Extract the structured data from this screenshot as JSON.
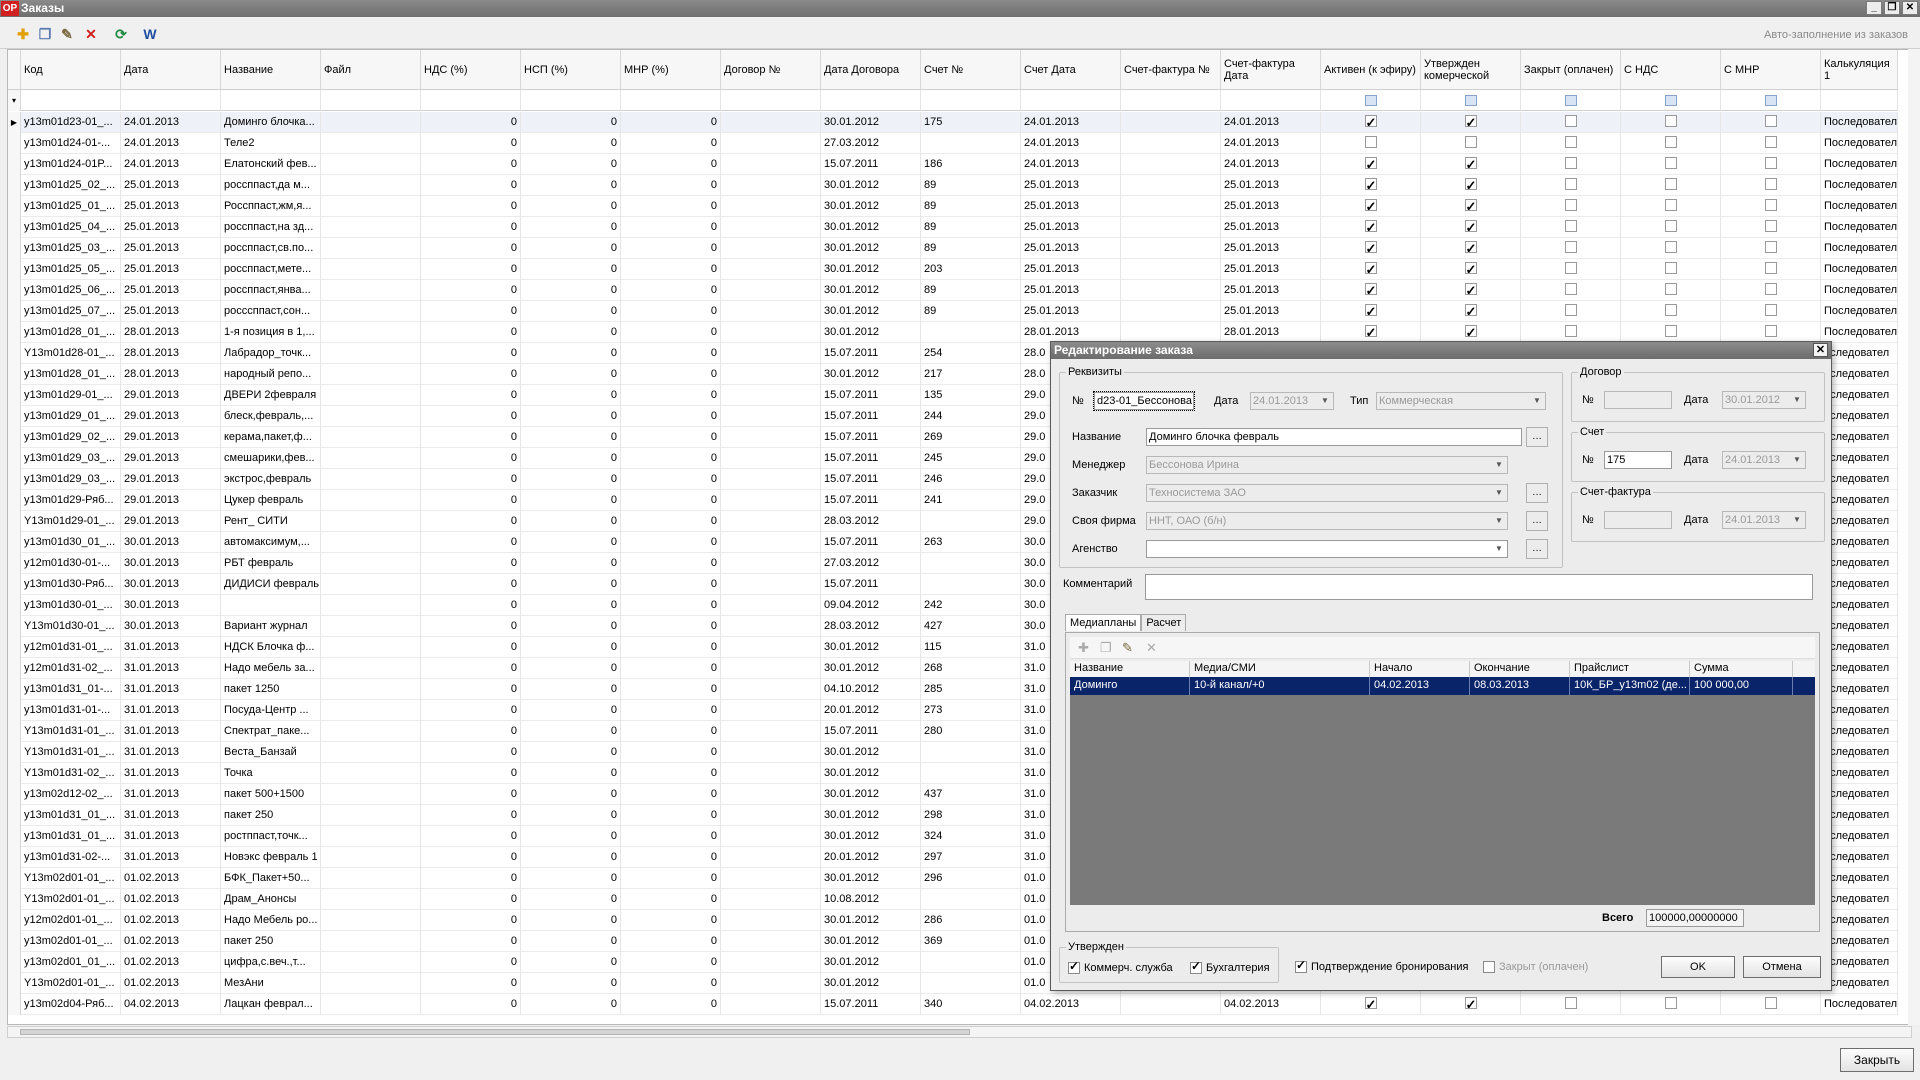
{
  "window": {
    "title": "Заказы",
    "logo": "OP"
  },
  "toolbar": {
    "autofill": "Авто-заполнение из заказов"
  },
  "columns": [
    {
      "label": "Код",
      "w": 100
    },
    {
      "label": "Дата",
      "w": 100
    },
    {
      "label": "Название",
      "w": 100
    },
    {
      "label": "Файл",
      "w": 100
    },
    {
      "label": "НДС (%)",
      "w": 100
    },
    {
      "label": "НСП (%)",
      "w": 100
    },
    {
      "label": "МНР (%)",
      "w": 100
    },
    {
      "label": "Договор №",
      "w": 100
    },
    {
      "label": "Дата Договора",
      "w": 100
    },
    {
      "label": "Счет №",
      "w": 100
    },
    {
      "label": "Счет Дата",
      "w": 100
    },
    {
      "label": "Счет-фактура №",
      "w": 100
    },
    {
      "label": "Счет-фактура Дата",
      "w": 100
    },
    {
      "label": "Активен (к эфиру)",
      "w": 100
    },
    {
      "label": "Утвержден комерческой",
      "w": 100
    },
    {
      "label": "Закрыт (оплачен)",
      "w": 100
    },
    {
      "label": "С НДС",
      "w": 100
    },
    {
      "label": "С МНР",
      "w": 100
    },
    {
      "label": "Калькуляция 1",
      "w": 77
    }
  ],
  "rows": [
    [
      "y13m01d23-01_...",
      "24.01.2013",
      "Доминго блочка...",
      "",
      "0",
      "0",
      "0",
      "",
      "30.01.2012",
      "175",
      "24.01.2013",
      "",
      "24.01.2013",
      1,
      1,
      0,
      0,
      0,
      "Последовател"
    ],
    [
      "y13m01d24-01-...",
      "24.01.2013",
      "Теле2",
      "",
      "0",
      "0",
      "0",
      "",
      "27.03.2012",
      "",
      "24.01.2013",
      "",
      "24.01.2013",
      0,
      0,
      0,
      0,
      0,
      "Последовател"
    ],
    [
      "y13m01d24-01P...",
      "24.01.2013",
      "Елатонский фев...",
      "",
      "0",
      "0",
      "0",
      "",
      "15.07.2011",
      "186",
      "24.01.2013",
      "",
      "24.01.2013",
      1,
      1,
      0,
      0,
      0,
      "Последовател"
    ],
    [
      "y13m01d25_02_...",
      "25.01.2013",
      "россппаст,да м...",
      "",
      "0",
      "0",
      "0",
      "",
      "30.01.2012",
      "89",
      "25.01.2013",
      "",
      "25.01.2013",
      1,
      1,
      0,
      0,
      0,
      "Последовател"
    ],
    [
      "y13m01d25_01_...",
      "25.01.2013",
      "Россппаст,жм,я...",
      "",
      "0",
      "0",
      "0",
      "",
      "30.01.2012",
      "89",
      "25.01.2013",
      "",
      "25.01.2013",
      1,
      1,
      0,
      0,
      0,
      "Последовател"
    ],
    [
      "y13m01d25_04_...",
      "25.01.2013",
      "россппаст,на зд...",
      "",
      "0",
      "0",
      "0",
      "",
      "30.01.2012",
      "89",
      "25.01.2013",
      "",
      "25.01.2013",
      1,
      1,
      0,
      0,
      0,
      "Последовател"
    ],
    [
      "y13m01d25_03_...",
      "25.01.2013",
      "россппаст,св.по...",
      "",
      "0",
      "0",
      "0",
      "",
      "30.01.2012",
      "89",
      "25.01.2013",
      "",
      "25.01.2013",
      1,
      1,
      0,
      0,
      0,
      "Последовател"
    ],
    [
      "y13m01d25_05_...",
      "25.01.2013",
      "россппаст,мете...",
      "",
      "0",
      "0",
      "0",
      "",
      "30.01.2012",
      "203",
      "25.01.2013",
      "",
      "25.01.2013",
      1,
      1,
      0,
      0,
      0,
      "Последовател"
    ],
    [
      "y13m01d25_06_...",
      "25.01.2013",
      "россппаст,янва...",
      "",
      "0",
      "0",
      "0",
      "",
      "30.01.2012",
      "89",
      "25.01.2013",
      "",
      "25.01.2013",
      1,
      1,
      0,
      0,
      0,
      "Последовател"
    ],
    [
      "y13m01d25_07_...",
      "25.01.2013",
      "росссппаст,сон...",
      "",
      "0",
      "0",
      "0",
      "",
      "30.01.2012",
      "89",
      "25.01.2013",
      "",
      "25.01.2013",
      1,
      1,
      0,
      0,
      0,
      "Последовател"
    ],
    [
      "y13m01d28_01_...",
      "28.01.2013",
      "1-я позиция в 1,...",
      "",
      "0",
      "0",
      "0",
      "",
      "30.01.2012",
      "",
      "28.01.2013",
      "",
      "28.01.2013",
      1,
      1,
      0,
      0,
      0,
      "Последовател"
    ],
    [
      "Y13m01d28-01_...",
      "28.01.2013",
      "Лабрадор_точк...",
      "",
      "0",
      "0",
      "0",
      "",
      "15.07.2011",
      "254",
      "28.0",
      "",
      "",
      0,
      0,
      0,
      0,
      0,
      "оследовател"
    ],
    [
      "y13m01d28_01_...",
      "28.01.2013",
      "народный репо...",
      "",
      "0",
      "0",
      "0",
      "",
      "30.01.2012",
      "217",
      "28.0",
      "",
      "",
      0,
      0,
      0,
      0,
      0,
      "оследовател"
    ],
    [
      "y13m01d29-01_...",
      "29.01.2013",
      "ДВЕРИ 2февраля",
      "",
      "0",
      "0",
      "0",
      "",
      "15.07.2011",
      "135",
      "29.0",
      "",
      "",
      0,
      0,
      0,
      0,
      0,
      "оследовател"
    ],
    [
      "y13m01d29_01_...",
      "29.01.2013",
      "блеск,февраль,...",
      "",
      "0",
      "0",
      "0",
      "",
      "15.07.2011",
      "244",
      "29.0",
      "",
      "",
      0,
      0,
      0,
      0,
      0,
      "оследовател"
    ],
    [
      "y13m01d29_02_...",
      "29.01.2013",
      "керама,пакет,ф...",
      "",
      "0",
      "0",
      "0",
      "",
      "15.07.2011",
      "269",
      "29.0",
      "",
      "",
      0,
      0,
      0,
      0,
      0,
      "оследовател"
    ],
    [
      "y13m01d29_03_...",
      "29.01.2013",
      "смешарики,фев...",
      "",
      "0",
      "0",
      "0",
      "",
      "15.07.2011",
      "245",
      "29.0",
      "",
      "",
      0,
      0,
      0,
      0,
      0,
      "оследовател"
    ],
    [
      "y13m01d29_03_...",
      "29.01.2013",
      "экстрос,февраль",
      "",
      "0",
      "0",
      "0",
      "",
      "15.07.2011",
      "246",
      "29.0",
      "",
      "",
      0,
      0,
      0,
      0,
      0,
      "оследовател"
    ],
    [
      "y13m01d29-Ряб...",
      "29.01.2013",
      "Цукер февраль",
      "",
      "0",
      "0",
      "0",
      "",
      "15.07.2011",
      "241",
      "29.0",
      "",
      "",
      0,
      0,
      0,
      0,
      0,
      "оследовател"
    ],
    [
      "Y13m01d29-01_...",
      "29.01.2013",
      "Рент_ СИТИ",
      "",
      "0",
      "0",
      "0",
      "",
      "28.03.2012",
      "",
      "29.0",
      "",
      "",
      0,
      0,
      0,
      0,
      0,
      "оследовател"
    ],
    [
      "y13m01d30_01_...",
      "30.01.2013",
      "автомаксимум,...",
      "",
      "0",
      "0",
      "0",
      "",
      "15.07.2011",
      "263",
      "30.0",
      "",
      "",
      0,
      0,
      0,
      0,
      0,
      "оследовател"
    ],
    [
      "y12m01d30-01-...",
      "30.01.2013",
      "РБТ февраль",
      "",
      "0",
      "0",
      "0",
      "",
      "27.03.2012",
      "",
      "30.0",
      "",
      "",
      0,
      0,
      0,
      0,
      0,
      "оследовател"
    ],
    [
      "y13m01d30-Ряб...",
      "30.01.2013",
      "ДИДИСИ февраль",
      "",
      "0",
      "0",
      "0",
      "",
      "15.07.2011",
      "",
      "30.0",
      "",
      "",
      0,
      0,
      0,
      0,
      0,
      "оследовател"
    ],
    [
      "y13m01d30-01_...",
      "30.01.2013",
      "",
      "",
      "0",
      "0",
      "0",
      "",
      "09.04.2012",
      "242",
      "30.0",
      "",
      "",
      0,
      0,
      0,
      0,
      0,
      "оследовател"
    ],
    [
      "Y13m01d30-01_...",
      "30.01.2013",
      "Вариант журнал",
      "",
      "0",
      "0",
      "0",
      "",
      "28.03.2012",
      "427",
      "30.0",
      "",
      "",
      0,
      0,
      0,
      0,
      0,
      "оследовател"
    ],
    [
      "y12m01d31-01_...",
      "31.01.2013",
      "НДСК Блочка ф...",
      "",
      "0",
      "0",
      "0",
      "",
      "30.01.2012",
      "115",
      "31.0",
      "",
      "",
      0,
      0,
      0,
      0,
      0,
      "оследовател"
    ],
    [
      "y12m01d31-02_...",
      "31.01.2013",
      "Надо мебель за...",
      "",
      "0",
      "0",
      "0",
      "",
      "30.01.2012",
      "268",
      "31.0",
      "",
      "",
      0,
      0,
      0,
      0,
      0,
      "оследовател"
    ],
    [
      "y13m01d31_01-...",
      "31.01.2013",
      "пакет 1250",
      "",
      "0",
      "0",
      "0",
      "",
      "04.10.2012",
      "285",
      "31.0",
      "",
      "",
      0,
      0,
      0,
      0,
      0,
      "оследовател"
    ],
    [
      "y13m01d31-01-...",
      "31.01.2013",
      "Посуда-Центр ...",
      "",
      "0",
      "0",
      "0",
      "",
      "20.01.2012",
      "273",
      "31.0",
      "",
      "",
      0,
      0,
      0,
      0,
      0,
      "оследовател"
    ],
    [
      "Y13m01d31-01_...",
      "31.01.2013",
      "Спектрат_паке...",
      "",
      "0",
      "0",
      "0",
      "",
      "15.07.2011",
      "280",
      "31.0",
      "",
      "",
      0,
      0,
      0,
      0,
      0,
      "оследовател"
    ],
    [
      "Y13m01d31-01_...",
      "31.01.2013",
      "Веста_Банзай",
      "",
      "0",
      "0",
      "0",
      "",
      "30.01.2012",
      "",
      "31.0",
      "",
      "",
      0,
      0,
      0,
      0,
      0,
      "оследовател"
    ],
    [
      "Y13m01d31-02_...",
      "31.01.2013",
      "Точка",
      "",
      "0",
      "0",
      "0",
      "",
      "30.01.2012",
      "",
      "31.0",
      "",
      "",
      0,
      0,
      0,
      0,
      0,
      "оследовател"
    ],
    [
      "y13m02d12-02_...",
      "31.01.2013",
      "пакет 500+1500",
      "",
      "0",
      "0",
      "0",
      "",
      "30.01.2012",
      "437",
      "31.0",
      "",
      "",
      0,
      0,
      0,
      0,
      0,
      "оследовател"
    ],
    [
      "y13m01d31_01_...",
      "31.01.2013",
      "пакет 250",
      "",
      "0",
      "0",
      "0",
      "",
      "30.01.2012",
      "298",
      "31.0",
      "",
      "",
      0,
      0,
      0,
      0,
      0,
      "оследовател"
    ],
    [
      "y13m01d31_01_...",
      "31.01.2013",
      "ростппаст,точк...",
      "",
      "0",
      "0",
      "0",
      "",
      "30.01.2012",
      "324",
      "31.0",
      "",
      "",
      0,
      0,
      0,
      0,
      0,
      "оследовател"
    ],
    [
      "y13m01d31-02-...",
      "31.01.2013",
      "Новэкс февраль 1",
      "",
      "0",
      "0",
      "0",
      "",
      "20.01.2012",
      "297",
      "31.0",
      "",
      "",
      0,
      0,
      0,
      0,
      0,
      "оследовател"
    ],
    [
      "Y13m02d01-01_...",
      "01.02.2013",
      "БФК_Пакет+50...",
      "",
      "0",
      "0",
      "0",
      "",
      "30.01.2012",
      "296",
      "01.0",
      "",
      "",
      0,
      0,
      0,
      0,
      0,
      "оследовател"
    ],
    [
      "Y13m02d01-01_...",
      "01.02.2013",
      "Драм_Анонсы",
      "",
      "0",
      "0",
      "0",
      "",
      "10.08.2012",
      "",
      "01.0",
      "",
      "",
      0,
      0,
      0,
      0,
      0,
      "оследовател"
    ],
    [
      "y12m02d01-01_...",
      "01.02.2013",
      "Надо Мебель ро...",
      "",
      "0",
      "0",
      "0",
      "",
      "30.01.2012",
      "286",
      "01.0",
      "",
      "",
      0,
      0,
      0,
      0,
      0,
      "оследовател"
    ],
    [
      "y13m02d01-01_...",
      "01.02.2013",
      "пакет 250",
      "",
      "0",
      "0",
      "0",
      "",
      "30.01.2012",
      "369",
      "01.0",
      "",
      "",
      0,
      0,
      0,
      0,
      0,
      "оследовател"
    ],
    [
      "y13m02d01_01_...",
      "01.02.2013",
      "цифра,с.веч.,т...",
      "",
      "0",
      "0",
      "0",
      "",
      "30.01.2012",
      "",
      "01.0",
      "",
      "",
      0,
      0,
      0,
      0,
      0,
      "оследовател"
    ],
    [
      "Y13m02d01-01_...",
      "01.02.2013",
      "МезАни",
      "",
      "0",
      "0",
      "0",
      "",
      "30.01.2012",
      "",
      "01.0",
      "",
      "",
      0,
      0,
      0,
      0,
      0,
      "оследовател"
    ],
    [
      "y13m02d04-Ряб...",
      "04.02.2013",
      "Лацкан феврал...",
      "",
      "0",
      "0",
      "0",
      "",
      "15.07.2011",
      "340",
      "04.02.2013",
      "",
      "04.02.2013",
      1,
      1,
      0,
      0,
      0,
      "Последовател"
    ]
  ],
  "close_label": "Закрыть",
  "dialog": {
    "title": "Редактирование заказа",
    "req_label": "Реквизиты",
    "num_label": "№",
    "num_value": "d23-01_Бессонова",
    "date_label": "Дата",
    "date_value": "24.01.2013",
    "type_label": "Тип",
    "type_value": "Коммерческая",
    "name_label": "Название",
    "name_value": "Доминго блочка февраль",
    "manager_label": "Менеджер",
    "manager_value": "Бессонова Ирина",
    "customer_label": "Заказчик",
    "customer_value": "Техносистема ЗАО",
    "firm_label": "Своя фирма",
    "firm_value": "ННТ, ОАО (б/н)",
    "agency_label": "Агенство",
    "agency_value": "",
    "contract_label": "Договор",
    "contract_num_label": "№",
    "contract_num": "",
    "contract_date_label": "Дата",
    "contract_date": "30.01.2012",
    "invoice_label": "Счет",
    "invoice_num_label": "№",
    "invoice_num": "175",
    "invoice_date_label": "Дата",
    "invoice_date": "24.01.2013",
    "sf_label": "Счет-фактура",
    "sf_num_label": "№",
    "sf_num": "",
    "sf_date_label": "Дата",
    "sf_date": "24.01.2013",
    "comment_label": "Комментарий",
    "comment_value": "",
    "tab_media": "Медиапланы",
    "tab_calc": "Расчет",
    "media_cols": [
      "Название",
      "Медиа/СМИ",
      "Начало",
      "Окончание",
      "Прайслист",
      "Сумма"
    ],
    "media_rows": [
      [
        "Доминго",
        "10-й канал/+0",
        "04.02.2013",
        "08.03.2013",
        "10К_БР_y13m02 (де...",
        "100 000,00"
      ]
    ],
    "total_label": "Всего",
    "total_value": "100000,00000000",
    "approved_label": "Утвержден",
    "chk_commerce": "Коммерч. служба",
    "chk_account": "Бухгалтерия",
    "chk_confirm": "Подтверждение бронирования",
    "chk_closed": "Закрыт (оплачен)",
    "ok": "OK",
    "cancel": "Отмена"
  },
  "colors": {
    "selected": "#0a246a",
    "titlebar": "#7a7a7a"
  }
}
